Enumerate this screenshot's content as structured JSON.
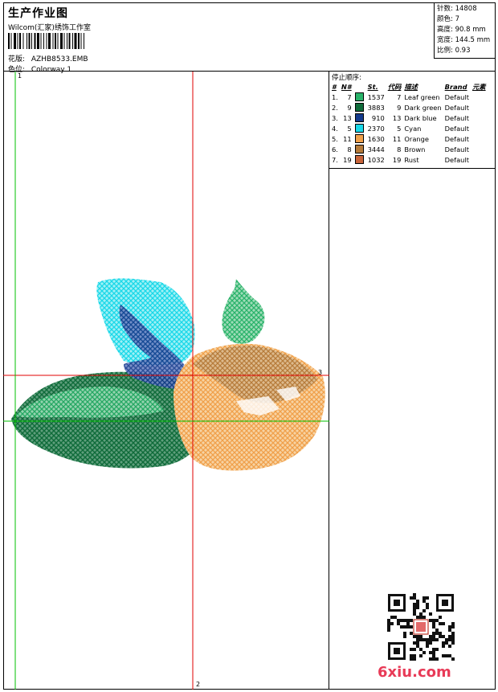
{
  "header": {
    "title": "生产作业图",
    "company": "Wilcom(汇家)绣饰工作室",
    "design_label": "花版:",
    "design_value": "AZHB8533.EMB",
    "colorway_label": "色位:",
    "colorway_value": "Colorway 1"
  },
  "stats": {
    "stitches": "针数: 14808",
    "colors": "颜色: 7",
    "height": "高度: 90.8 mm",
    "width": "宽度: 144.5 mm",
    "scale": "比例: 0.93"
  },
  "stop_sequence": {
    "title": "停止顺序:",
    "headers": [
      "#",
      "N#",
      "St.",
      "代码",
      "描述",
      "Brand",
      "元素"
    ],
    "rows": [
      {
        "index": "1.",
        "n": "7",
        "color": "#29b36a",
        "stitches": "1537",
        "code": "7",
        "desc": "Leaf green",
        "brand": "Default"
      },
      {
        "index": "2.",
        "n": "9",
        "color": "#0f6b3a",
        "stitches": "3883",
        "code": "9",
        "desc": "Dark green",
        "brand": "Default"
      },
      {
        "index": "3.",
        "n": "13",
        "color": "#143a8c",
        "stitches": "910",
        "code": "13",
        "desc": "Dark blue",
        "brand": "Default"
      },
      {
        "index": "4.",
        "n": "5",
        "color": "#19d8e8",
        "stitches": "2370",
        "code": "5",
        "desc": "Cyan",
        "brand": "Default"
      },
      {
        "index": "5.",
        "n": "11",
        "color": "#f0a04a",
        "stitches": "1630",
        "code": "11",
        "desc": "Orange",
        "brand": "Default"
      },
      {
        "index": "6.",
        "n": "8",
        "color": "#b47a3a",
        "stitches": "3444",
        "code": "8",
        "desc": "Brown",
        "brand": "Default"
      },
      {
        "index": "7.",
        "n": "19",
        "color": "#c8643a",
        "stitches": "1032",
        "code": "19",
        "desc": "Rust",
        "brand": "Default"
      }
    ]
  },
  "canvas": {
    "axis_marks": {
      "top_left": "1",
      "right": "3",
      "bottom": "2"
    }
  },
  "watermark": "6xiu.com",
  "colors": {
    "crosshair_red": "#e00000",
    "crosshair_green": "#00c000"
  }
}
